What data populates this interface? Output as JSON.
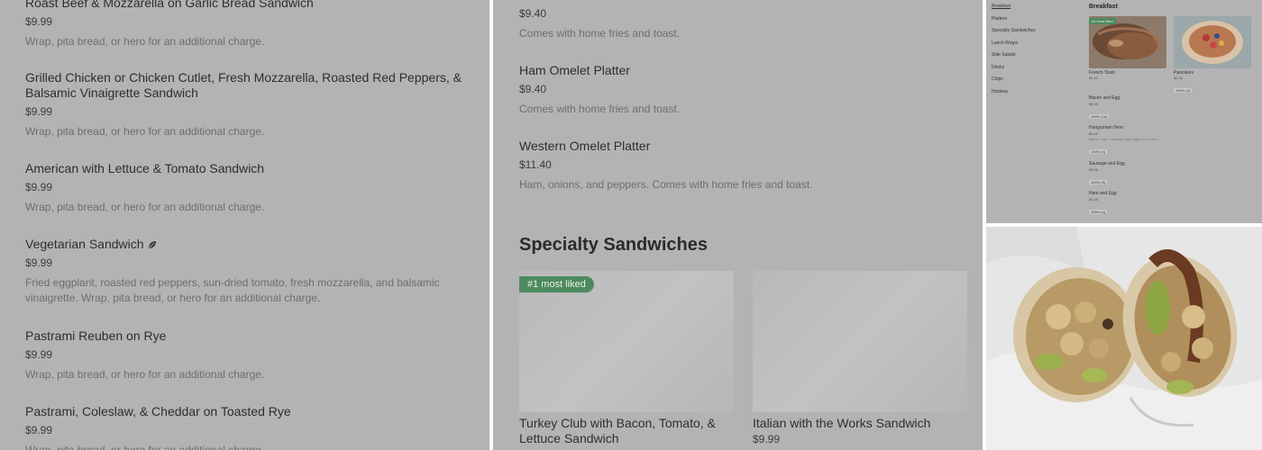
{
  "left_panel": {
    "items": [
      {
        "title": "Roast Beef & Mozzarella on Garlic Bread Sandwich",
        "price": "$9.99",
        "desc": "Wrap, pita bread, or hero for an additional charge."
      },
      {
        "title": "Grilled Chicken or Chicken Cutlet, Fresh Mozzarella, Roasted Red Peppers, & Balsamic Vinaigrette Sandwich",
        "price": "$9.99",
        "desc": "Wrap, pita bread, or hero for an additional charge."
      },
      {
        "title": "American with Lettuce & Tomato Sandwich",
        "price": "$9.99",
        "desc": "Wrap, pita bread, or hero for an additional charge."
      },
      {
        "title": "Vegetarian Sandwich",
        "price": "$9.99",
        "desc": "Fried eggplant, roasted red peppers, sun-dried tomato, fresh mozzarella, and balsamic vinaigrette. Wrap, pita bread, or hero for an additional charge."
      },
      {
        "title": "Pastrami Reuben on Rye",
        "price": "$9.99",
        "desc": "Wrap, pita bread, or hero for an additional charge."
      },
      {
        "title": "Pastrami, Coleslaw, & Cheddar on Toasted Rye",
        "price": "$9.99",
        "desc": "Wrap, pita bread, or hero for an additional charge."
      }
    ],
    "leaf_icon": "leaf-icon"
  },
  "middle_panel": {
    "items": [
      {
        "title": "",
        "price": "$9.40",
        "desc": "Comes with home fries and toast."
      },
      {
        "title": "Ham Omelet Platter",
        "price": "$9.40",
        "desc": "Comes with home fries and toast."
      },
      {
        "title": "Western Omelet Platter",
        "price": "$11.40",
        "desc": "Ham, onions, and peppers. Comes with home fries and toast."
      }
    ],
    "section_title": "Specialty Sandwiches",
    "cards": [
      {
        "badge": "#1 most liked",
        "title": "Turkey Club with Bacon, Tomato, & Lettuce Sandwich",
        "price": ""
      },
      {
        "badge": "",
        "title": "Italian with the Works Sandwich",
        "price": "$9.99"
      }
    ]
  },
  "thumbnail_panel": {
    "nav": [
      "Breakfast",
      "Platters",
      "Specialty Sandwiches",
      "Lunch Wraps",
      "Side Salads",
      "Drinks",
      "Chips",
      "Hostess"
    ],
    "heading": "Breakfast",
    "cards": [
      {
        "badge": "#1 most liked",
        "title": "French Toast",
        "price": "$6.40",
        "rating": ""
      },
      {
        "badge": "",
        "title": "Pancakes",
        "price": "$6.40",
        "rating": "100% (4)"
      }
    ],
    "items": [
      {
        "title": "Bacon and Egg",
        "price": "$5.45",
        "desc": "",
        "rating": "100% (18)"
      },
      {
        "title": "Hungryman Hero",
        "price": "$9.45",
        "desc": "Bacon, ham, sausage, and eggs on a hero.",
        "rating": "100% (4)"
      },
      {
        "title": "Sausage and Egg",
        "price": "$5.45",
        "desc": "",
        "rating": "100% (5)"
      },
      {
        "title": "Ham and Egg",
        "price": "$5.45",
        "desc": "",
        "rating": "100% (4)"
      }
    ]
  },
  "photo_panel": {
    "subject": "wrap-sandwich-photo"
  },
  "colors": {
    "overlay_gray": "#b3b3b3",
    "badge_green": "#4e8a5f",
    "text_dark": "#2e2e2e",
    "text_muted": "#6e6e6e"
  }
}
